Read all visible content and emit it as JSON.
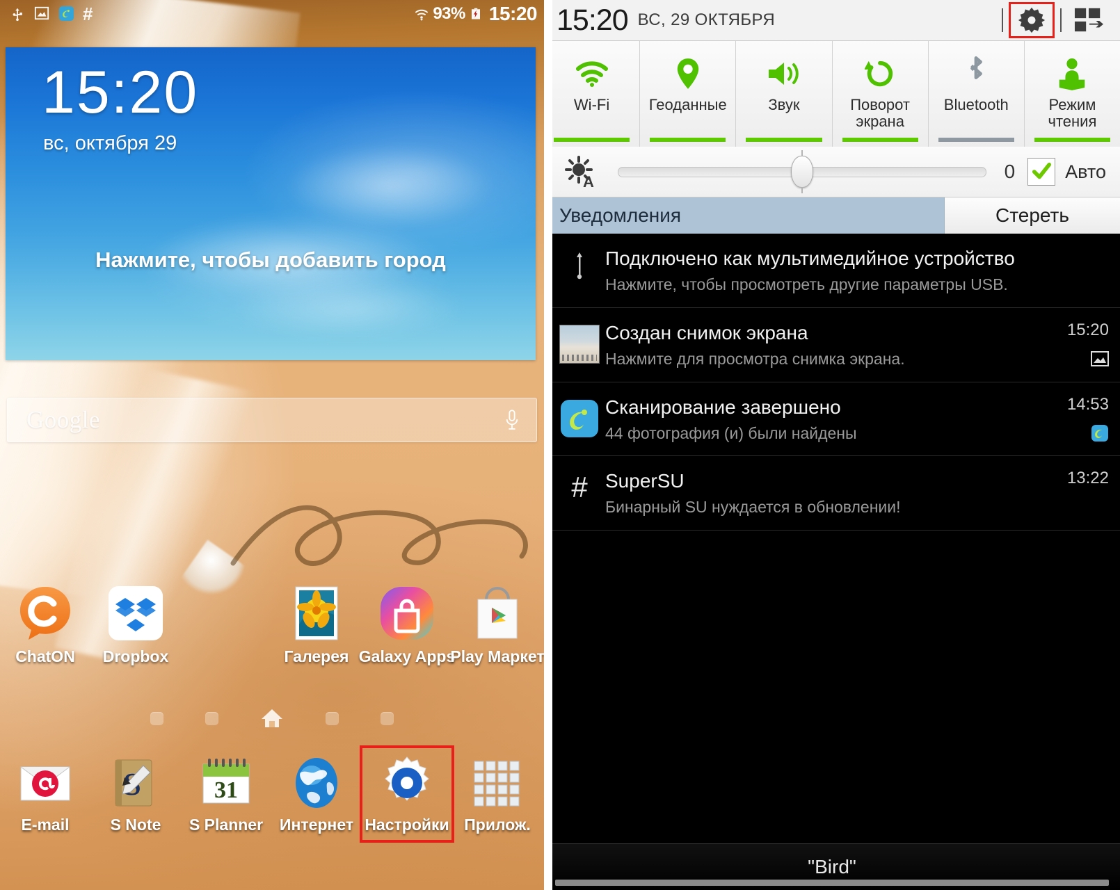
{
  "home": {
    "statusbar": {
      "icons": [
        "usb-icon",
        "screenshot-icon",
        "scanner-icon",
        "supersu-hash-icon"
      ],
      "wifi_icon": "wifi-icon",
      "battery_percent": "93%",
      "battery_icon": "battery-charging-icon",
      "time": "15:20"
    },
    "weather_widget": {
      "time": "15:20",
      "date": "вс, октября 29",
      "add_city_prompt": "Нажмите, чтобы добавить город"
    },
    "search": {
      "brand": "Google",
      "placeholder": "Google",
      "mic_icon": "microphone-icon"
    },
    "apps": [
      {
        "label": "ChatON",
        "icon": "chaton-icon"
      },
      {
        "label": "Dropbox",
        "icon": "dropbox-icon"
      },
      {
        "label": "Галерея",
        "icon": "gallery-icon"
      },
      {
        "label": "Galaxy Apps",
        "icon": "galaxy-apps-icon"
      },
      {
        "label": "Play Маркет",
        "icon": "play-store-icon"
      }
    ],
    "page_indicator": {
      "count": 5,
      "home_index": 2,
      "home_icon": "home-icon"
    },
    "dock": [
      {
        "label": "E-mail",
        "icon": "email-icon",
        "highlighted": false
      },
      {
        "label": "S Note",
        "icon": "snote-icon",
        "highlighted": false
      },
      {
        "label": "S Planner",
        "icon": "calendar-icon",
        "highlighted": false,
        "day": "31"
      },
      {
        "label": "Интернет",
        "icon": "browser-icon",
        "highlighted": false
      },
      {
        "label": "Настройки",
        "icon": "settings-gear-icon",
        "highlighted": true
      },
      {
        "label": "Прилож.",
        "icon": "apps-grid-icon",
        "highlighted": false
      }
    ]
  },
  "shade": {
    "header": {
      "time": "15:20",
      "date": "ВС, 29 ОКТЯБРЯ",
      "settings_icon": "gear-icon",
      "multiwindow_icon": "multi-window-icon",
      "settings_highlighted": true
    },
    "toggles": [
      {
        "label": "Wi-Fi",
        "icon": "wifi-icon",
        "state": "on"
      },
      {
        "label": "Геоданные",
        "icon": "location-pin-icon",
        "state": "on"
      },
      {
        "label": "Звук",
        "icon": "volume-icon",
        "state": "on"
      },
      {
        "label": "Поворот\nэкрана",
        "icon": "rotate-icon",
        "state": "on"
      },
      {
        "label": "Bluetooth",
        "icon": "bluetooth-icon",
        "state": "off"
      },
      {
        "label": "Режим\nчтения",
        "icon": "reading-mode-icon",
        "state": "on"
      }
    ],
    "brightness": {
      "icon": "brightness-auto-icon",
      "value": "0",
      "auto_label": "Авто",
      "auto_checked": true,
      "slider_percent": 47
    },
    "notifications_header": {
      "title": "Уведомления",
      "clear_label": "Стереть"
    },
    "notifications": [
      {
        "icon": "usb-icon",
        "title": "Подключено как мультимедийное устройство",
        "subtitle": "Нажмите, чтобы просмотреть другие параметры USB.",
        "time": "",
        "badge": ""
      },
      {
        "icon": "screenshot-thumbnail",
        "title": "Создан снимок экрана",
        "subtitle": "Нажмите для просмотра снимка экрана.",
        "time": "15:20",
        "badge": "image-icon"
      },
      {
        "icon": "scanner-icon",
        "title": "Сканирование завершено",
        "subtitle": "44 фотография (и) были найдены",
        "time": "14:53",
        "badge": "scanner-small-icon"
      },
      {
        "icon": "supersu-hash-icon",
        "title": "SuperSU",
        "subtitle": "Бинарный SU нуждается в обновлении!",
        "time": "13:22",
        "badge": ""
      }
    ],
    "footer": {
      "label": "\"Bird\""
    }
  },
  "colors": {
    "accent_green": "#5ec800",
    "toggle_off": "#8d98a0",
    "highlight_red": "#e8201a",
    "notif_header_bg": "#aec3d6",
    "shade_bg": "#000000"
  }
}
